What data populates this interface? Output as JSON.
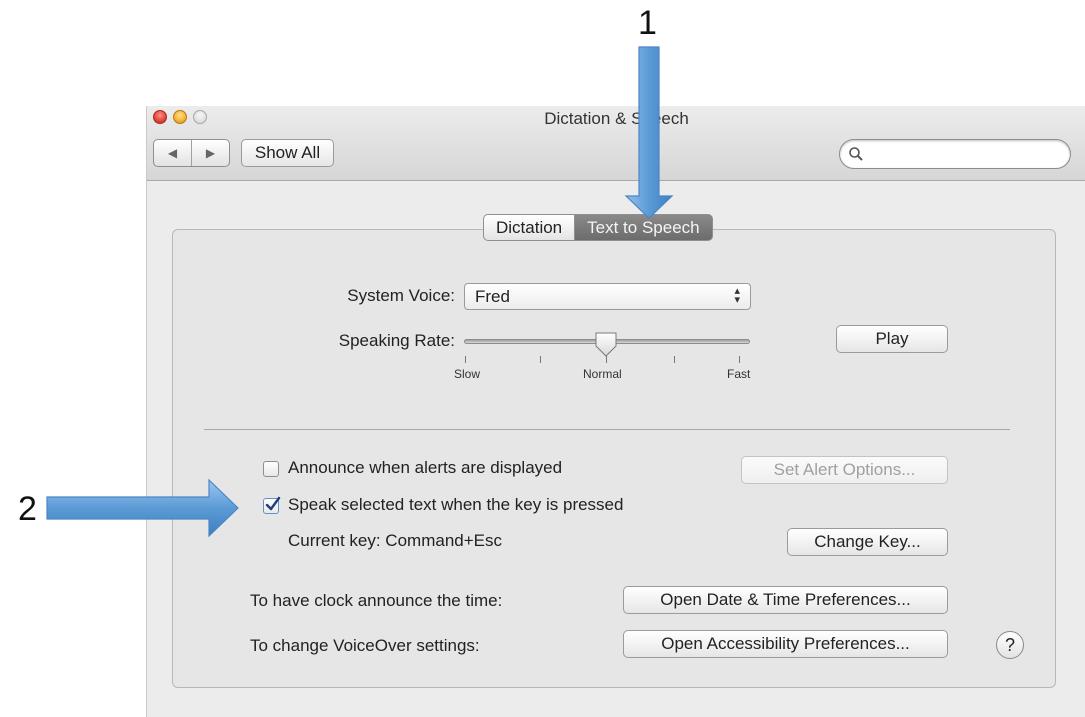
{
  "annotations": {
    "arrow_1_number": "1",
    "arrow_2_number": "2",
    "arrow_color": "#5b9bd5"
  },
  "window": {
    "title": "Dictation & Speech",
    "show_all_label": "Show All",
    "nav_back_icon": "◀",
    "nav_forward_icon": "▶",
    "search": {
      "placeholder": ""
    }
  },
  "tabs": {
    "dictation": "Dictation",
    "text_to_speech": "Text to Speech",
    "selected": "Text to Speech"
  },
  "voice": {
    "system_voice_label": "System Voice:",
    "system_voice_value": "Fred",
    "speaking_rate_label": "Speaking Rate:",
    "rate_slow": "Slow",
    "rate_normal": "Normal",
    "rate_fast": "Fast",
    "rate_position": 0.5,
    "play_label": "Play"
  },
  "options": {
    "announce_alerts_label": "Announce when alerts are displayed",
    "announce_alerts_checked": false,
    "set_alert_options_label": "Set Alert Options...",
    "speak_selected_label": "Speak selected text when the key is pressed",
    "speak_selected_checked": true,
    "current_key_text": "Current key: Command+Esc",
    "change_key_label": "Change Key...",
    "clock_label": "To have clock announce the time:",
    "open_date_time_label": "Open Date & Time Preferences...",
    "voiceover_label": "To change VoiceOver settings:",
    "open_accessibility_label": "Open Accessibility Preferences...",
    "help_label": "?"
  }
}
